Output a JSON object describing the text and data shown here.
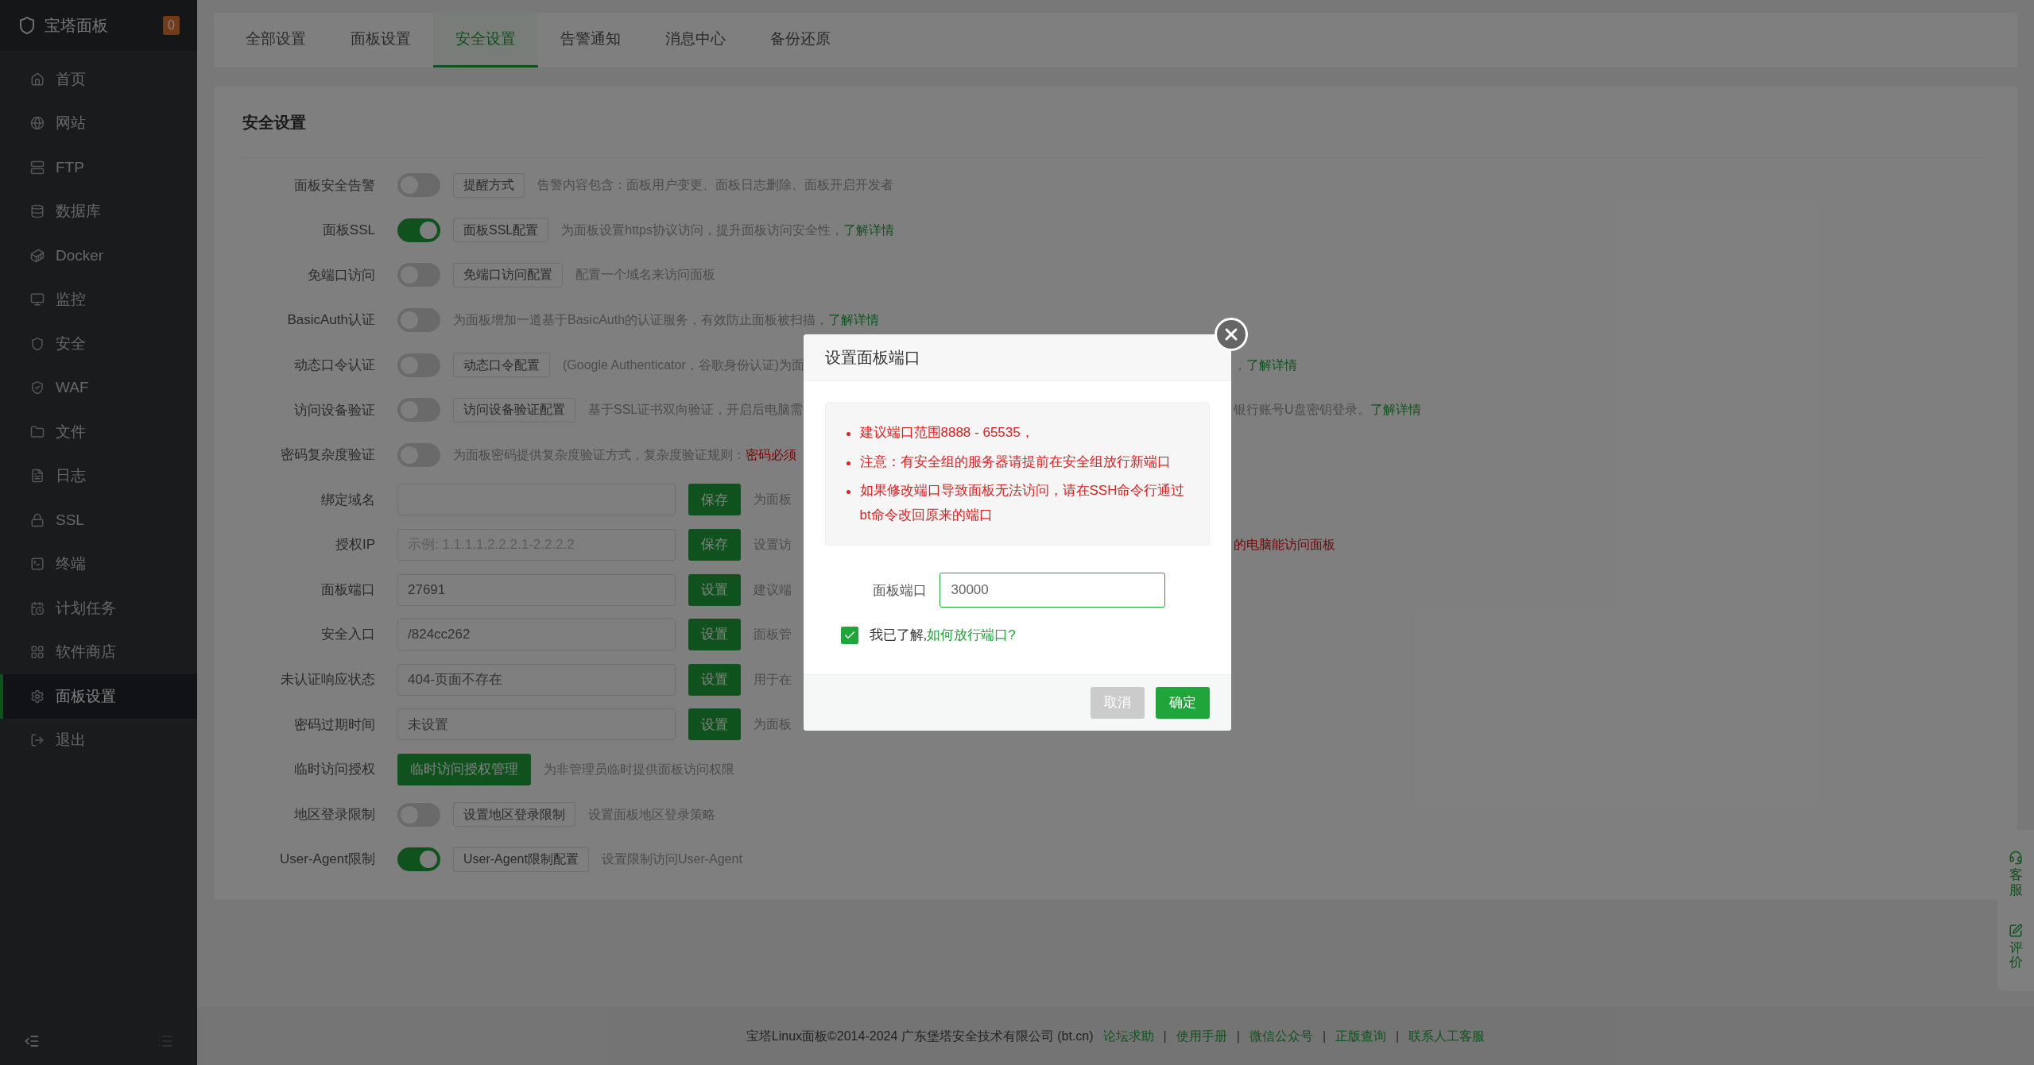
{
  "sidebar": {
    "logo": "宝塔面板",
    "badge": "0",
    "items": [
      {
        "label": "首页",
        "selected": false
      },
      {
        "label": "网站",
        "selected": false
      },
      {
        "label": "FTP",
        "selected": false
      },
      {
        "label": "数据库",
        "selected": false
      },
      {
        "label": "Docker",
        "selected": false
      },
      {
        "label": "监控",
        "selected": false
      },
      {
        "label": "安全",
        "selected": false
      },
      {
        "label": "WAF",
        "selected": false
      },
      {
        "label": "文件",
        "selected": false
      },
      {
        "label": "日志",
        "selected": false
      },
      {
        "label": "SSL",
        "selected": false
      },
      {
        "label": "终端",
        "selected": false
      },
      {
        "label": "计划任务",
        "selected": false
      },
      {
        "label": "软件商店",
        "selected": false
      },
      {
        "label": "面板设置",
        "selected": true
      },
      {
        "label": "退出",
        "selected": false
      }
    ]
  },
  "tabs": [
    {
      "label": "全部设置",
      "selected": false
    },
    {
      "label": "面板设置",
      "selected": false
    },
    {
      "label": "安全设置",
      "selected": true
    },
    {
      "label": "告警通知",
      "selected": false
    },
    {
      "label": "消息中心",
      "selected": false
    },
    {
      "label": "备份还原",
      "selected": false
    }
  ],
  "section_title": "安全设置",
  "rows": [
    {
      "kind": "toggle",
      "label": "面板安全告警",
      "on": false,
      "button": "提醒方式",
      "desc": [
        {
          "text": "告警内容包含：面板用户变更、面板日志删除、面板开启开发者",
          "kind": "plain"
        }
      ]
    },
    {
      "kind": "toggle",
      "label": "面板SSL",
      "on": true,
      "button": "面板SSL配置",
      "desc": [
        {
          "text": "为面板设置https协议访问，提升面板访问安全性，",
          "kind": "plain"
        },
        {
          "text": "了解详情",
          "kind": "link"
        }
      ]
    },
    {
      "kind": "toggle",
      "label": "免端口访问",
      "on": false,
      "button": "免端口访问配置",
      "desc": [
        {
          "text": "配置一个域名来访问面板",
          "kind": "plain"
        }
      ]
    },
    {
      "kind": "toggle",
      "label": "BasicAuth认证",
      "on": false,
      "desc": [
        {
          "text": "为面板增加一道基于BasicAuth的认证服务，有效防止面板被扫描，",
          "kind": "plain"
        },
        {
          "text": "了解详情",
          "kind": "link"
        }
      ]
    },
    {
      "kind": "toggle",
      "label": "动态口令认证",
      "on": false,
      "button": "动态口令配置",
      "desc": [
        {
          "text": "(Google Authenticator，谷歌身份认证)为面",
          "kind": "plain"
        }
      ],
      "tail": [
        {
          "text": "，",
          "kind": "plain"
        },
        {
          "text": "了解详情",
          "kind": "link"
        }
      ]
    },
    {
      "kind": "toggle",
      "label": "访问设备验证",
      "on": false,
      "button": "访问设备验证配置",
      "desc": [
        {
          "text": "基于SSL证书双向验证，开启后电脑需",
          "kind": "plain"
        }
      ],
      "tail": [
        {
          "text": "银行账号U盘密钥登录。",
          "kind": "plain"
        },
        {
          "text": "了解详情",
          "kind": "link"
        }
      ]
    },
    {
      "kind": "toggle",
      "label": "密码复杂度验证",
      "on": false,
      "desc": [
        {
          "text": "为面板密码提供复杂度验证方式，复杂度验证规则：",
          "kind": "plain"
        },
        {
          "text": "密码必须",
          "kind": "warn"
        }
      ]
    },
    {
      "kind": "input",
      "label": "绑定域名",
      "value": "",
      "button": "保存",
      "desc": [
        {
          "text": "为面板",
          "kind": "plain"
        }
      ]
    },
    {
      "kind": "input",
      "label": "授权IP",
      "placeholder": "示例: 1.1.1.1,2.2.2.1-2.2.2.2",
      "button": "保存",
      "desc": [
        {
          "text": "设置访",
          "kind": "plain"
        }
      ],
      "tail": [
        {
          "text": "的电脑能访问面板",
          "kind": "warn"
        }
      ]
    },
    {
      "kind": "input",
      "label": "面板端口",
      "value": "27691",
      "button": "设置",
      "desc": [
        {
          "text": "建议端",
          "kind": "plain"
        }
      ]
    },
    {
      "kind": "input",
      "label": "安全入口",
      "value": "/824cc262",
      "button": "设置",
      "desc": [
        {
          "text": "面板管",
          "kind": "plain"
        }
      ]
    },
    {
      "kind": "input",
      "label": "未认证响应状态",
      "value": "404-页面不存在",
      "button": "设置",
      "desc": [
        {
          "text": "用于在",
          "kind": "plain"
        }
      ]
    },
    {
      "kind": "input",
      "label": "密码过期时间",
      "value": "未设置",
      "button": "设置",
      "desc": [
        {
          "text": "为面板",
          "kind": "plain"
        }
      ]
    },
    {
      "kind": "action",
      "label": "临时访问授权",
      "button": "临时访问授权管理",
      "desc": [
        {
          "text": "为非管理员临时提供面板访问权限",
          "kind": "plain"
        }
      ]
    },
    {
      "kind": "toggle",
      "label": "地区登录限制",
      "on": false,
      "button": "设置地区登录限制",
      "desc": [
        {
          "text": "设置面板地区登录策略",
          "kind": "plain"
        }
      ]
    },
    {
      "kind": "toggle",
      "label": "User-Agent限制",
      "on": true,
      "button": "User-Agent限制配置",
      "desc": [
        {
          "text": "设置限制访问User-Agent",
          "kind": "plain"
        }
      ]
    }
  ],
  "footer": {
    "copyright": "宝塔Linux面板©2014-2024 广东堡塔安全技术有限公司 (bt.cn)",
    "separator": "|",
    "links": [
      "论坛求助",
      "使用手册",
      "微信公众号",
      "正版查询",
      "联系人工客服"
    ]
  },
  "side_widget": [
    {
      "kind": "support",
      "label": "客服"
    },
    {
      "kind": "review",
      "label": "评价"
    }
  ],
  "dialog": {
    "title": "设置面板端口",
    "notes": [
      "建议端口范围8888 - 65535，",
      "注意：有安全组的服务器请提前在安全组放行新端口",
      "如果修改端口导致面板无法访问，请在SSH命令行通过bt命令改回原来的端口"
    ],
    "field_label": "面板端口",
    "field_value": "30000",
    "agree_checked": true,
    "agree_text": "我已了解,",
    "agree_link": "如何放行端口?",
    "buttons": [
      {
        "label": "取消",
        "kind": "secondary"
      },
      {
        "label": "确定",
        "kind": "primary"
      }
    ]
  }
}
